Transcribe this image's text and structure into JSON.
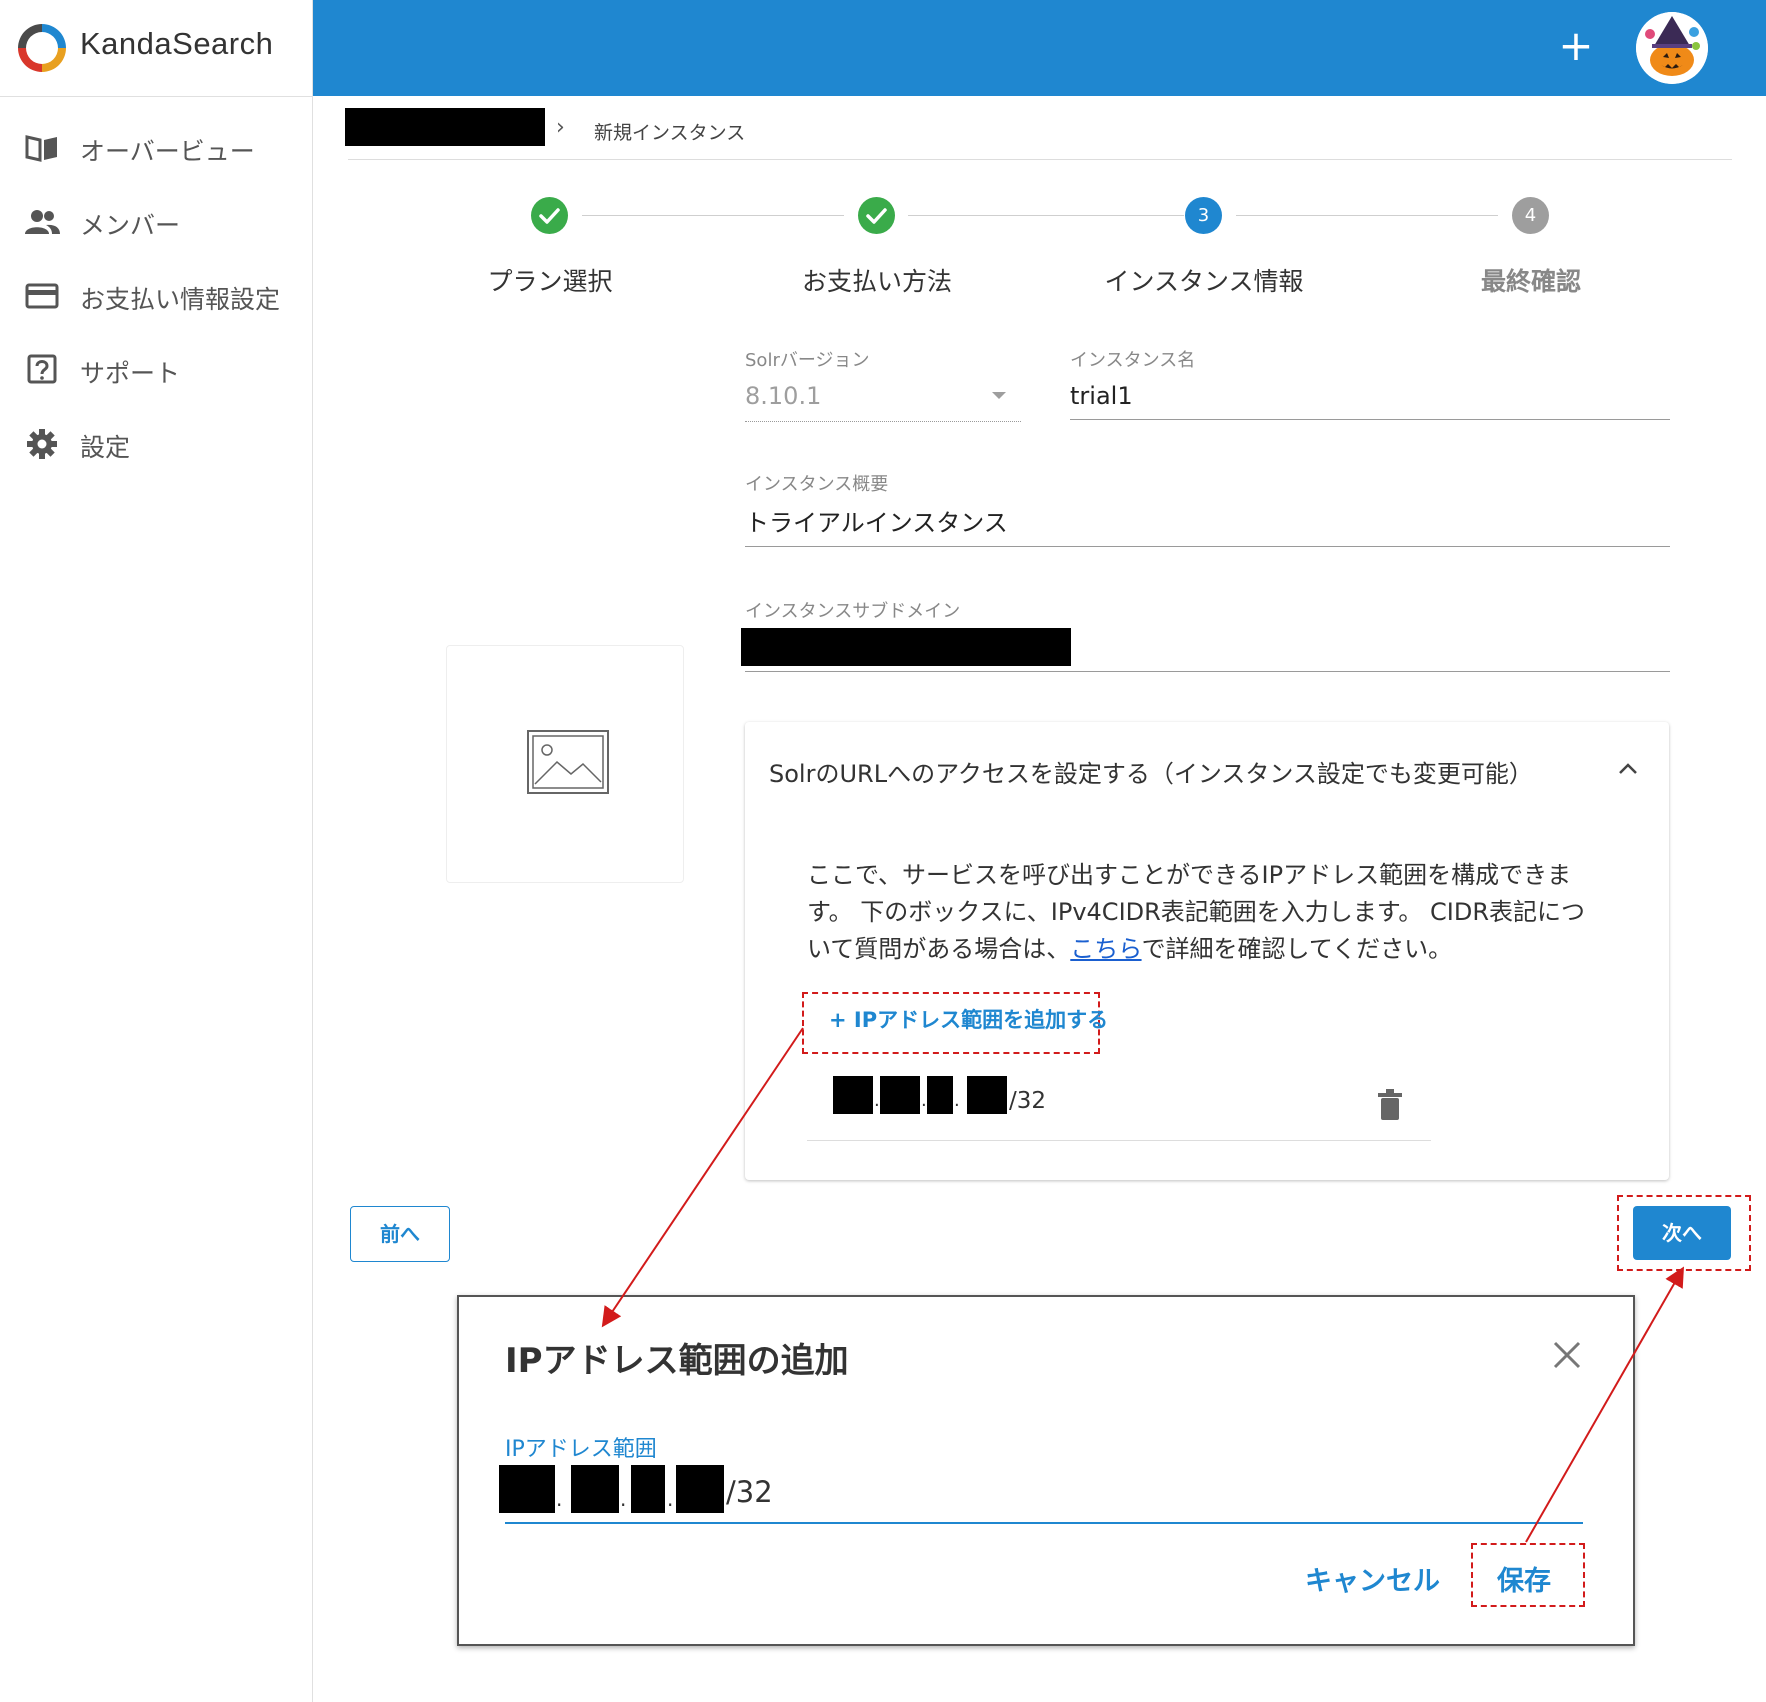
{
  "app": {
    "name": "KandaSearch"
  },
  "sidebar": {
    "items": [
      {
        "label": "オーバービュー",
        "icon": "book-icon"
      },
      {
        "label": "メンバー",
        "icon": "people-icon"
      },
      {
        "label": "お支払い情報設定",
        "icon": "credit-card-icon"
      },
      {
        "label": "サポート",
        "icon": "help-icon"
      },
      {
        "label": "設定",
        "icon": "gear-icon"
      }
    ]
  },
  "header": {
    "add_label": "+"
  },
  "breadcrumb": {
    "separator": "›",
    "current": "新規インスタンス"
  },
  "stepper": {
    "steps": [
      {
        "label": "プラン選択",
        "state": "done",
        "number": ""
      },
      {
        "label": "お支払い方法",
        "state": "done",
        "number": ""
      },
      {
        "label": "インスタンス情報",
        "state": "active",
        "number": "3"
      },
      {
        "label": "最終確認",
        "state": "pending",
        "number": "4"
      }
    ]
  },
  "form": {
    "solr_version": {
      "label": "Solrバージョン",
      "value": "8.10.1"
    },
    "instance_name": {
      "label": "インスタンス名",
      "value": "trial1"
    },
    "instance_summary": {
      "label": "インスタンス概要",
      "value": "トライアルインスタンス"
    },
    "instance_subdomain": {
      "label": "インスタンスサブドメイン"
    }
  },
  "access_panel": {
    "title": "SolrのURLへのアクセスを設定する（インスタンス設定でも変更可能）",
    "desc_before": "ここで、サービスを呼び出すことができるIPアドレス範囲を構成できます。 下のボックスに、IPv4CIDR表記範囲を入力します。 CIDR表記について質問がある場合は、",
    "desc_link": "こちら",
    "desc_after": "で詳細を確認してください。",
    "add_button": "+ IPアドレス範囲を追加する",
    "ip_suffix": "/32",
    "ip_dots": [
      "."
    ]
  },
  "nav": {
    "prev": "前へ",
    "next": "次へ"
  },
  "dialog": {
    "title": "IPアドレス範囲の追加",
    "field_label": "IPアドレス範囲",
    "ip_suffix": "/32",
    "ip_dot": ".",
    "cancel": "キャンセル",
    "save": "保存"
  },
  "colors": {
    "brand_blue": "#1f87d0",
    "step_done": "#3aab4a",
    "step_pending": "#9e9e9e",
    "annotation_red": "#d21b1b"
  }
}
